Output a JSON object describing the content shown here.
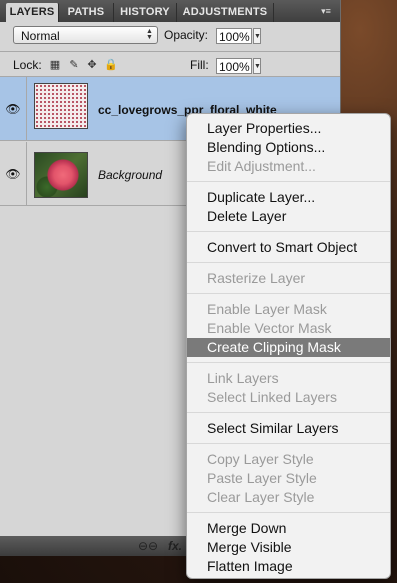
{
  "tabs": [
    {
      "label": "LAYERS",
      "active": true
    },
    {
      "label": "PATHS",
      "active": false
    },
    {
      "label": "HISTORY",
      "active": false
    },
    {
      "label": "ADJUSTMENTS",
      "active": false
    }
  ],
  "controls": {
    "blend_mode": "Normal",
    "opacity_label": "Opacity:",
    "opacity_value": "100%",
    "lock_label": "Lock:",
    "fill_label": "Fill:",
    "fill_value": "100%"
  },
  "layers": [
    {
      "name": "cc_lovegrows_ppr_floral_white",
      "selected": true
    },
    {
      "name": "Background",
      "selected": false
    }
  ],
  "menu": {
    "groups": [
      [
        {
          "label": "Layer Properties...",
          "enabled": true
        },
        {
          "label": "Blending Options...",
          "enabled": true
        },
        {
          "label": "Edit Adjustment...",
          "enabled": false
        }
      ],
      [
        {
          "label": "Duplicate Layer...",
          "enabled": true
        },
        {
          "label": "Delete Layer",
          "enabled": true
        }
      ],
      [
        {
          "label": "Convert to Smart Object",
          "enabled": true
        }
      ],
      [
        {
          "label": "Rasterize Layer",
          "enabled": false
        }
      ],
      [
        {
          "label": "Enable Layer Mask",
          "enabled": false
        },
        {
          "label": "Enable Vector Mask",
          "enabled": false
        },
        {
          "label": "Create Clipping Mask",
          "enabled": true,
          "highlighted": true
        }
      ],
      [
        {
          "label": "Link Layers",
          "enabled": false
        },
        {
          "label": "Select Linked Layers",
          "enabled": false
        }
      ],
      [
        {
          "label": "Select Similar Layers",
          "enabled": true
        }
      ],
      [
        {
          "label": "Copy Layer Style",
          "enabled": false
        },
        {
          "label": "Paste Layer Style",
          "enabled": false
        },
        {
          "label": "Clear Layer Style",
          "enabled": false
        }
      ],
      [
        {
          "label": "Merge Down",
          "enabled": true
        },
        {
          "label": "Merge Visible",
          "enabled": true
        },
        {
          "label": "Flatten Image",
          "enabled": true
        }
      ]
    ]
  },
  "icons": {
    "eye": "eye-icon",
    "link": "link-icon",
    "fx": "fx-icon"
  }
}
